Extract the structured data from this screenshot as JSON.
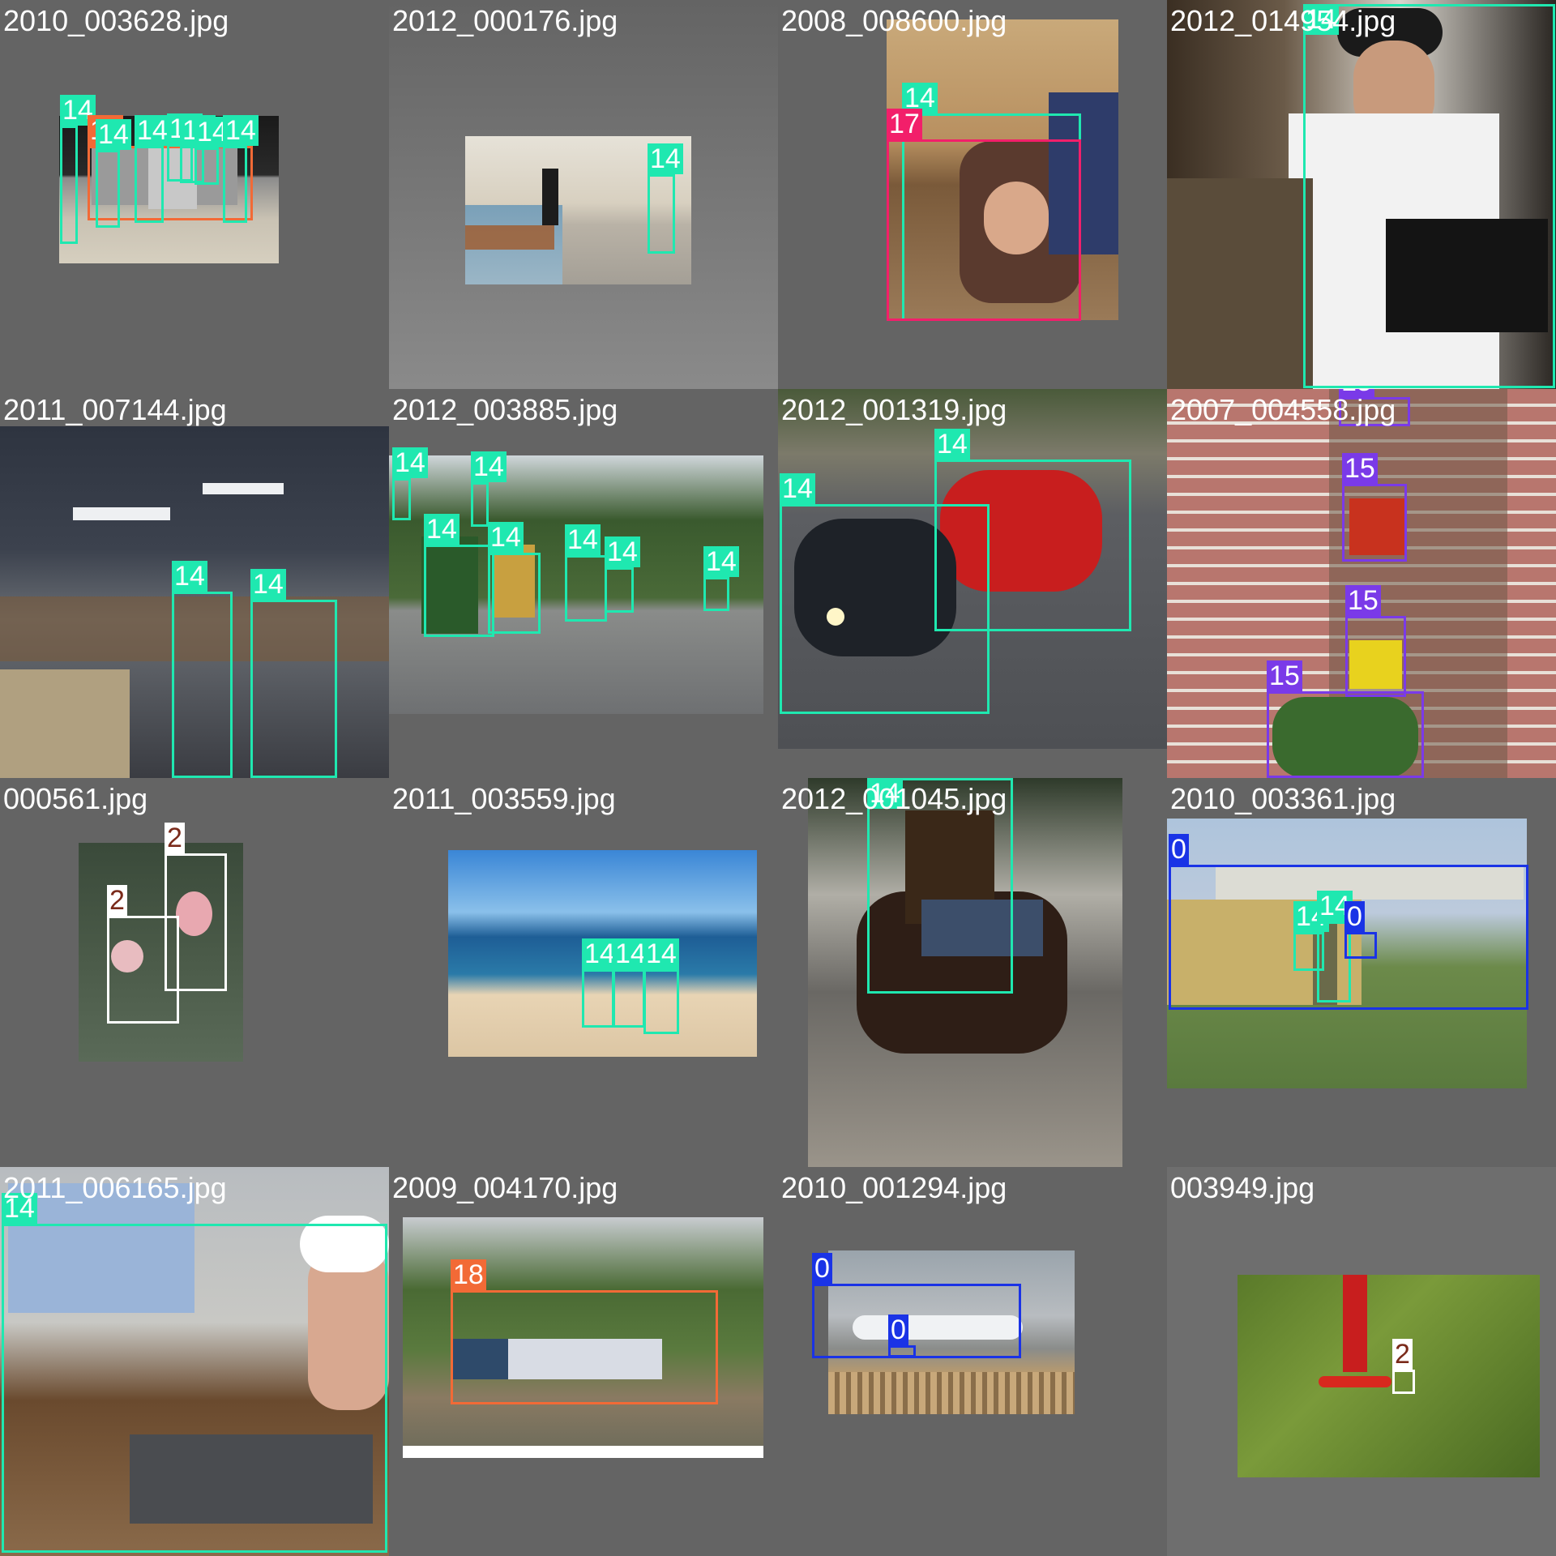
{
  "title": "Validation batch labels mosaic",
  "class_colors": {
    "0": "#1a33e6",
    "2": "#ffffff",
    "14": "#1fe8b0",
    "15": "#7a3ae8",
    "17": "#f21f6a",
    "18": "#f26a36"
  },
  "tiles": [
    {
      "file": "2010_003628.jpg",
      "boxes": [
        {
          "label": "14"
        },
        {
          "label": "18"
        },
        {
          "label": "14"
        },
        {
          "label": "14"
        },
        {
          "label": "14"
        },
        {
          "label": "14"
        },
        {
          "label": "14"
        },
        {
          "label": "14"
        }
      ]
    },
    {
      "file": "2012_000176.jpg",
      "boxes": [
        {
          "label": "14"
        }
      ]
    },
    {
      "file": "2008_008600.jpg",
      "boxes": [
        {
          "label": "14"
        },
        {
          "label": "17"
        }
      ]
    },
    {
      "file": "2012_014954.jpg",
      "boxes": [
        {
          "label": "14"
        }
      ]
    },
    {
      "file": "2011_007144.jpg",
      "boxes": [
        {
          "label": "14"
        },
        {
          "label": "14"
        }
      ]
    },
    {
      "file": "2012_003885.jpg",
      "boxes": [
        {
          "label": "14"
        },
        {
          "label": "14"
        },
        {
          "label": "14"
        },
        {
          "label": "14"
        },
        {
          "label": "14"
        },
        {
          "label": "14"
        },
        {
          "label": "14"
        }
      ]
    },
    {
      "file": "2012_001319.jpg",
      "boxes": [
        {
          "label": "14"
        },
        {
          "label": "14"
        }
      ]
    },
    {
      "file": "2007_004558.jpg",
      "boxes": [
        {
          "label": "15"
        },
        {
          "label": "15"
        },
        {
          "label": "15"
        },
        {
          "label": "15"
        }
      ]
    },
    {
      "file": "000561.jpg",
      "boxes": [
        {
          "label": "2"
        },
        {
          "label": "2"
        }
      ]
    },
    {
      "file": "2011_003559.jpg",
      "boxes": [
        {
          "label": "14"
        },
        {
          "label": "14"
        },
        {
          "label": "14"
        }
      ]
    },
    {
      "file": "2012_001045.jpg",
      "boxes": [
        {
          "label": "14"
        }
      ]
    },
    {
      "file": "2010_003361.jpg",
      "boxes": [
        {
          "label": "0"
        },
        {
          "label": "14"
        },
        {
          "label": "14"
        },
        {
          "label": "0"
        }
      ]
    },
    {
      "file": "2011_006165.jpg",
      "boxes": [
        {
          "label": "14"
        }
      ]
    },
    {
      "file": "2009_004170.jpg",
      "boxes": [
        {
          "label": "18"
        }
      ]
    },
    {
      "file": "2010_001294.jpg",
      "boxes": [
        {
          "label": "0"
        },
        {
          "label": "0"
        }
      ]
    },
    {
      "file": "003949.jpg",
      "boxes": [
        {
          "label": "2"
        }
      ]
    }
  ]
}
